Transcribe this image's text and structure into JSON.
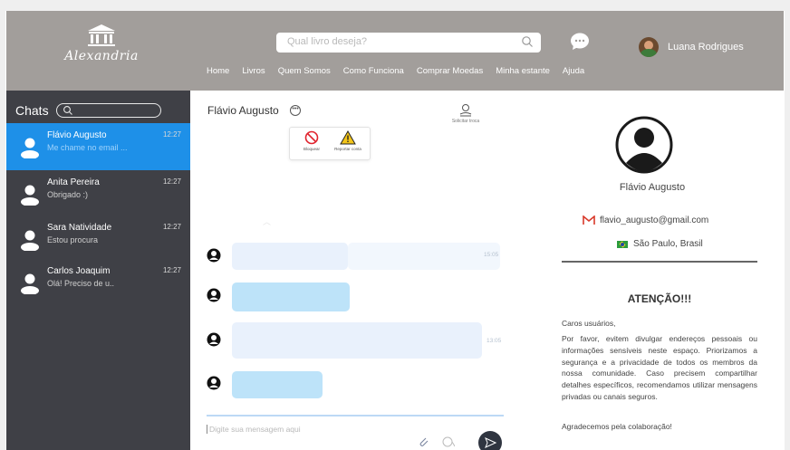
{
  "header": {
    "logo_text": "Alexandria",
    "search_placeholder": "Qual livro deseja?",
    "user_name": "Luana Rodrigues",
    "nav": [
      "Home",
      "Livros",
      "Quem Somos",
      "Como Funciona",
      "Comprar Moedas",
      "Minha estante",
      "Ajuda"
    ]
  },
  "sidebar": {
    "title": "Chats",
    "chats": [
      {
        "name": "Flávio Augusto",
        "preview": "Me chame no email ...",
        "time": "12:27",
        "active": true
      },
      {
        "name": "Anita Pereira",
        "preview": "Obrigado :)",
        "time": "12:27",
        "active": false
      },
      {
        "name": "Sara Natividade",
        "preview": "Estou procura",
        "time": "12:27",
        "active": false
      },
      {
        "name": "Carlos Joaquim",
        "preview": "Olá! Preciso de u..",
        "time": "12:27",
        "active": false
      }
    ]
  },
  "conversation": {
    "title": "Flávio Augusto",
    "menu": {
      "block_label": "Bloquear",
      "report_label": "Reportar conta"
    },
    "trade_label": "Solicitar troca",
    "message_times": [
      "15:05",
      "13:05"
    ],
    "input_placeholder": "Digite sua mensagem aqui"
  },
  "profile": {
    "name": "Flávio Augusto",
    "email": "flavio_augusto@gmail.com",
    "location": "São Paulo, Brasil",
    "notice_title": "ATENÇÃO!!!",
    "notice_greeting": "Caros usuários,",
    "notice_body": "Por favor, evitem divulgar endereços pessoais ou informações sensíveis neste espaço. Priorizamos a segurança e a privacidade de todos os membros da nossa comunidade. Caso precisem compartilhar detalhes específicos, recomendamos utilizar mensagens privadas ou canais seguros.",
    "notice_thanks": "Agradecemos pela colaboração!"
  },
  "colors": {
    "header_bg": "#a29e9b",
    "sidebar_bg": "#3f4046",
    "active_chat": "#1e90e8",
    "bubble_light": "#e9f1fc",
    "bubble_blue": "#bde3f9"
  }
}
